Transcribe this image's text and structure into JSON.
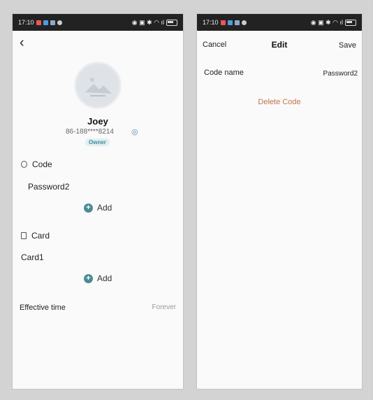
{
  "left_screen": {
    "status": {
      "time": "17:10"
    },
    "profile": {
      "name": "Joey",
      "phone": "86-188****8214",
      "role_badge": "Owner"
    },
    "code_section": {
      "title": "Code",
      "items": [
        "Password2"
      ],
      "add_label": "Add"
    },
    "card_section": {
      "title": "Card",
      "items": [
        "Card1"
      ],
      "add_label": "Add"
    },
    "effective_time": {
      "label": "Effective time",
      "value": "Forever"
    },
    "icons": {
      "back": "back-chevron-icon",
      "qr": "qr-code-icon",
      "code": "code-icon",
      "card": "card-icon",
      "add": "plus-circle-icon"
    },
    "colors": {
      "accent": "#4b8b94",
      "badge_text": "#3b8fa3"
    }
  },
  "right_screen": {
    "status": {
      "time": "17:10"
    },
    "nav": {
      "cancel": "Cancel",
      "title": "Edit",
      "save": "Save"
    },
    "field": {
      "label": "Code name",
      "value": "Password2"
    },
    "delete_label": "Delete Code",
    "colors": {
      "delete": "#c0744a"
    }
  }
}
